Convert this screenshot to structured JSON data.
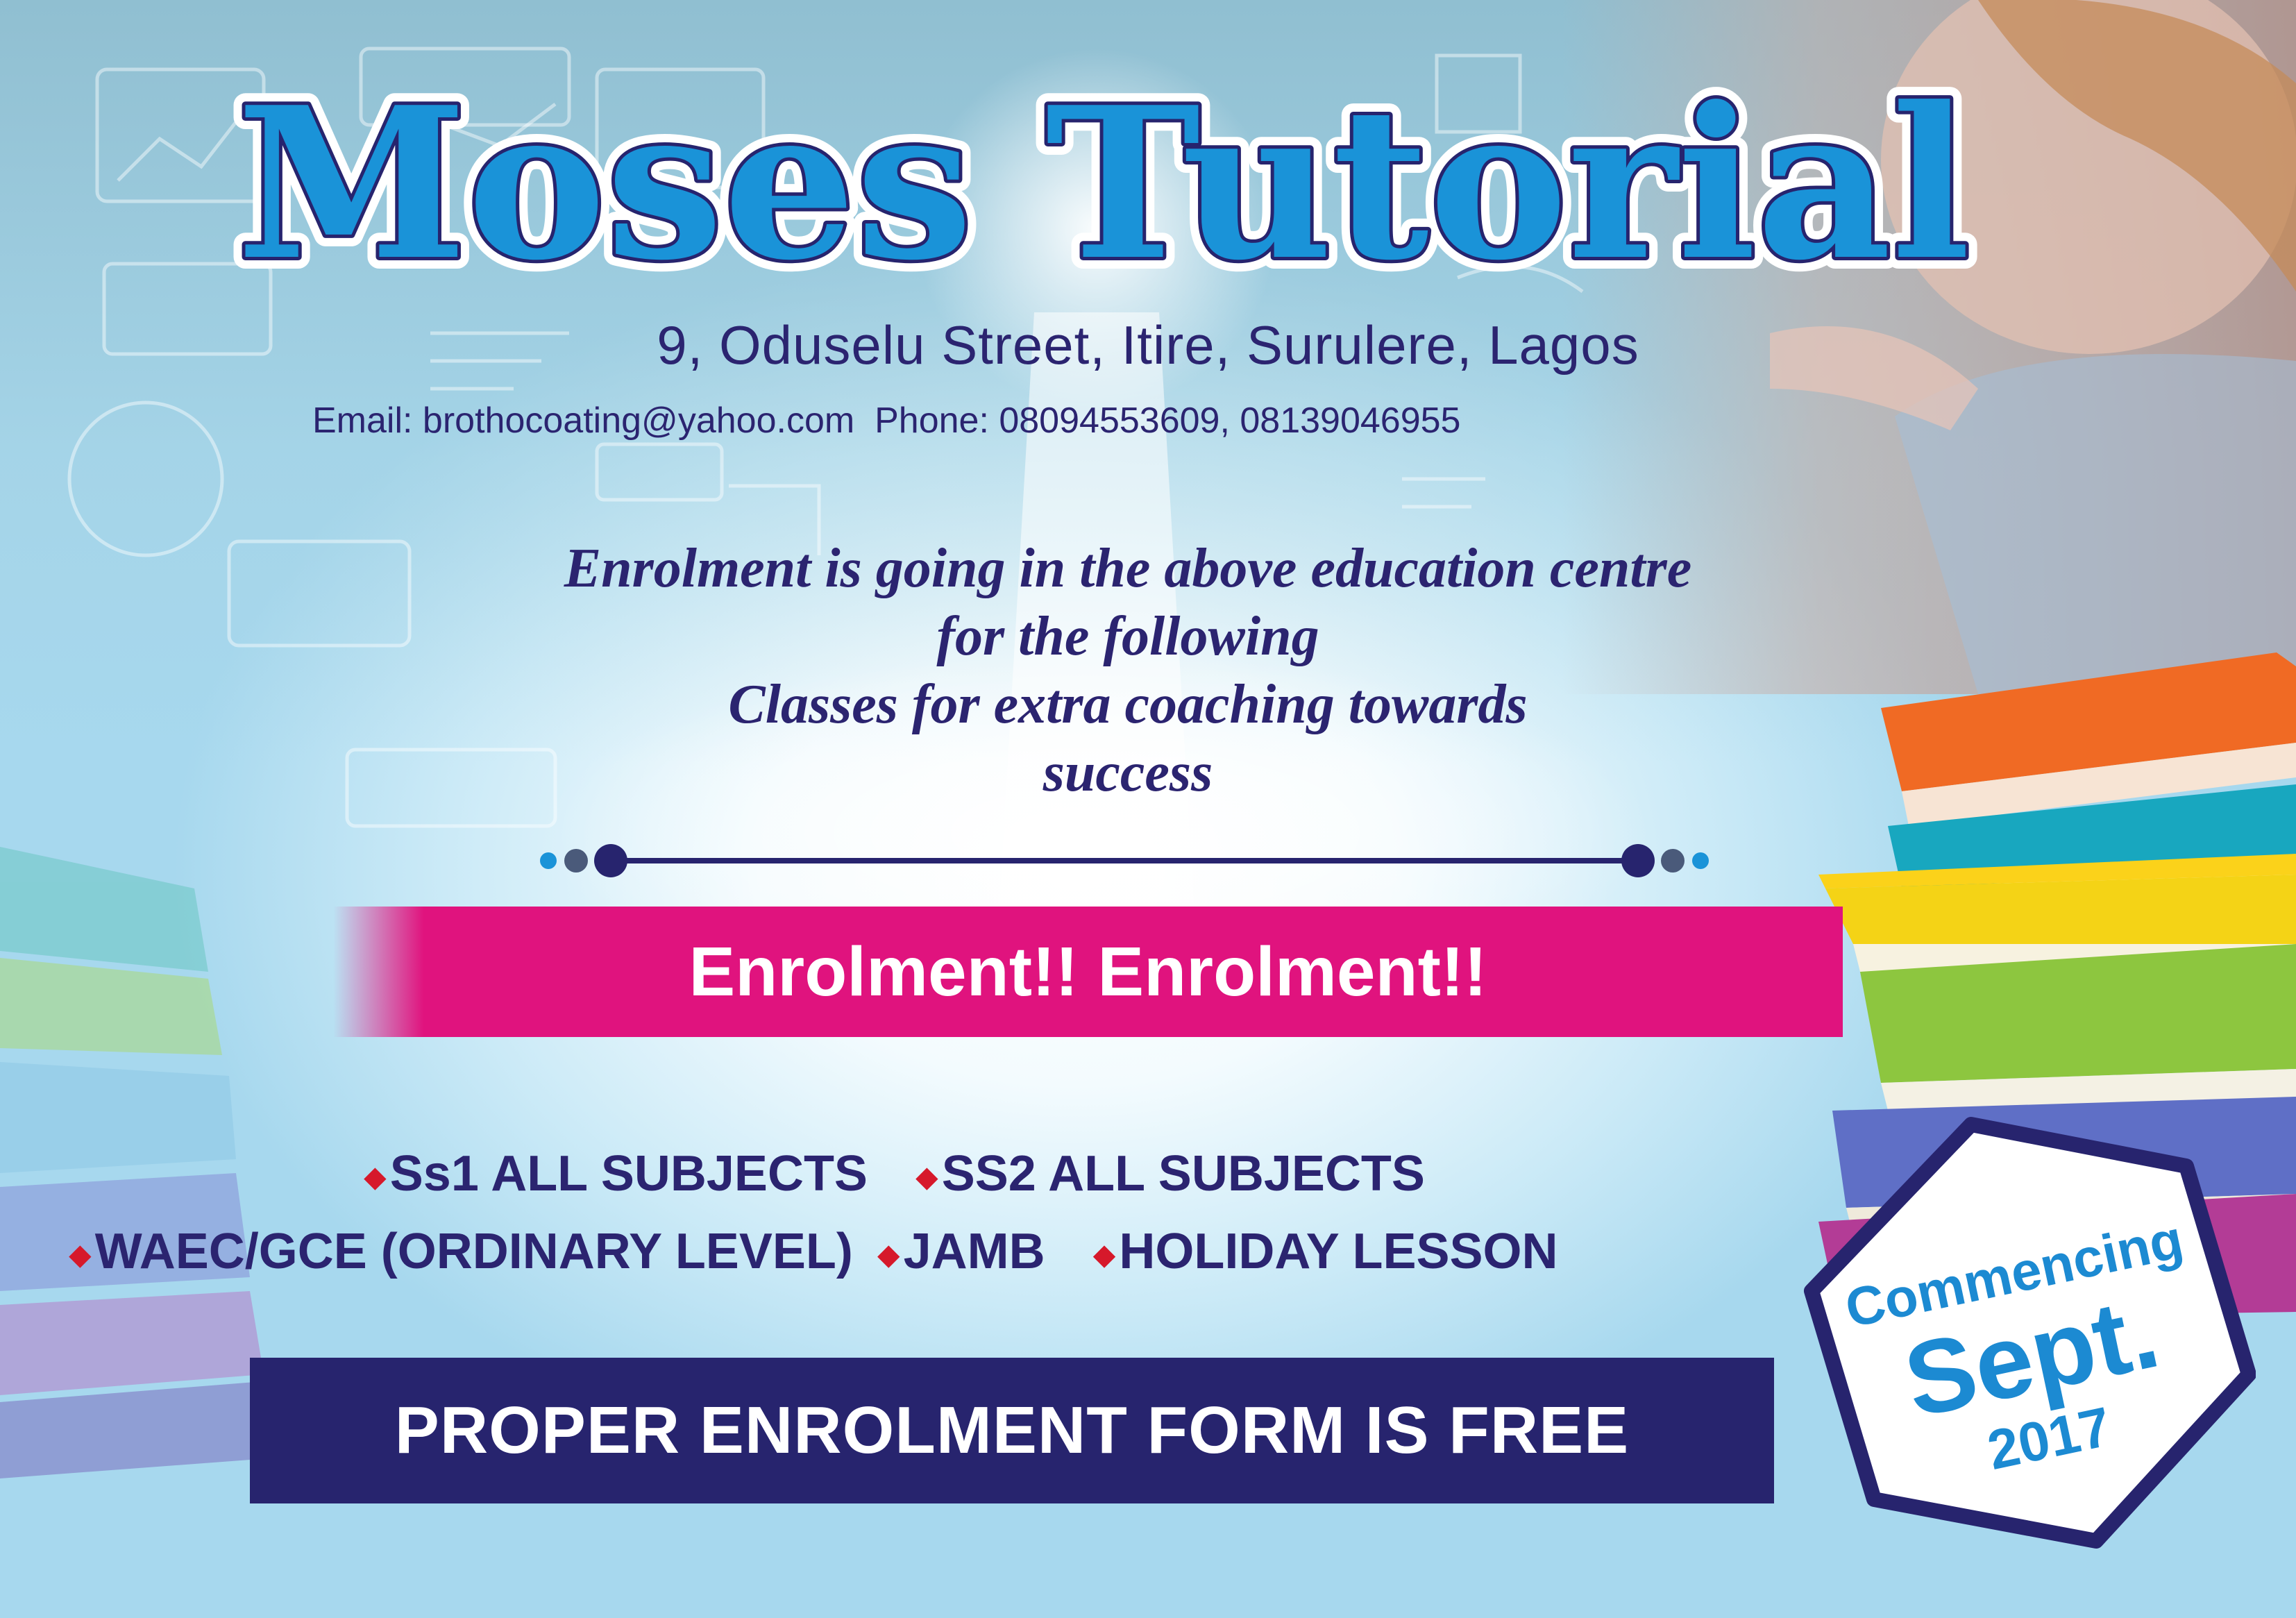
{
  "header": {
    "title": "Moses Tutorial",
    "address": "9, Oduselu Street, Itire, Surulere, Lagos",
    "contact": "Email: brothocoating@yahoo.com  Phone: 08094553609, 08139046955"
  },
  "intro": {
    "line1": "Enrolment is going in the above education centre",
    "line2": "for the following",
    "line3": "Classes for extra coaching towards",
    "line4": "success"
  },
  "banner": {
    "text": "Enrolment!! Enrolment!!"
  },
  "subjects": {
    "row1": [
      "Ss1 ALL SUBJECTS",
      "SS2 ALL SUBJECTS"
    ],
    "row2": [
      "WAEC/GCE (ORDINARY LEVEL)",
      "JAMB",
      "HOLIDAY LESSON"
    ]
  },
  "footer": {
    "free_form": "PROPER ENROLMENT FORM IS FREE"
  },
  "badge": {
    "line1": "Commencing",
    "line2": "Sept.",
    "line3": "2017"
  },
  "colors": {
    "navy": "#2b2470",
    "title_blue": "#1a93d8",
    "banner_pink": "#e0137e",
    "bullet_red": "#d6192b",
    "badge_blue": "#1c8ad2"
  }
}
